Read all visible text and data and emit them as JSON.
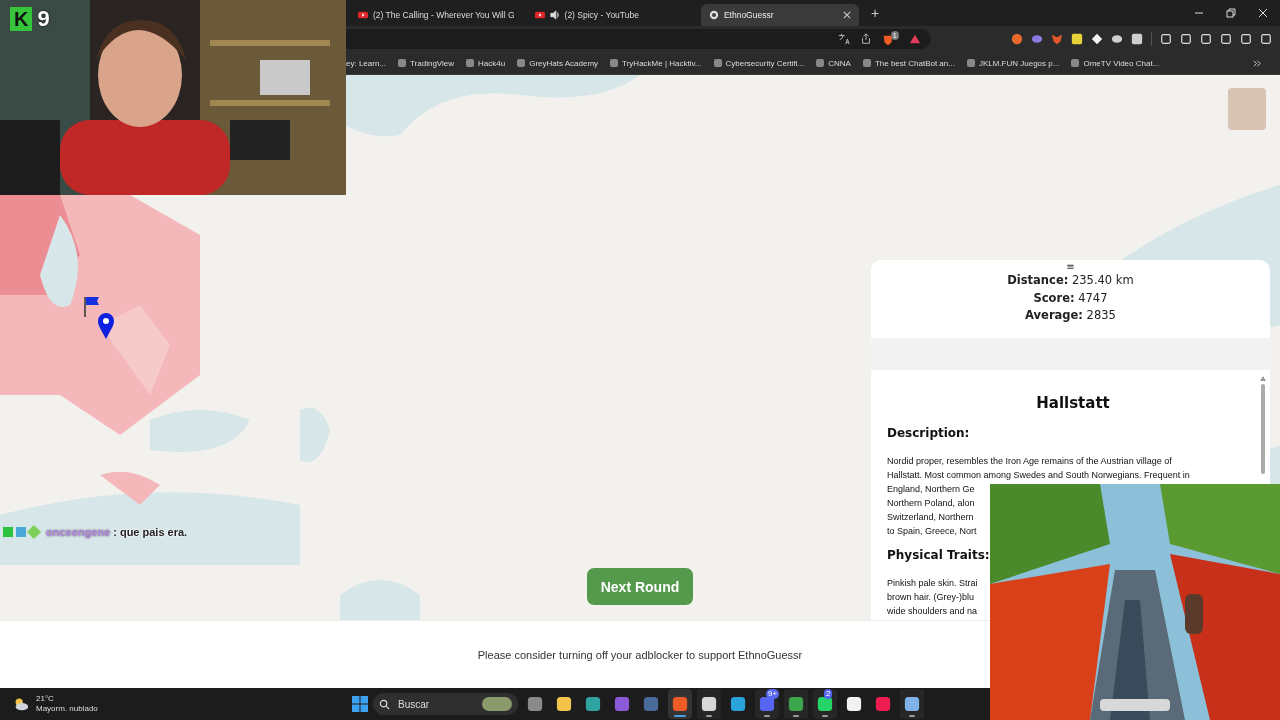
{
  "stream_overlay": {
    "logo_mark": "K",
    "logo_count": "9",
    "chat": {
      "user": "onceengene",
      "message": ": que pais era."
    }
  },
  "browser": {
    "tabs": [
      {
        "title": "(2) The Calling - Wherever You Will G",
        "selected": false,
        "audible": false
      },
      {
        "title": "(2) Spicy - YouTube",
        "selected": false,
        "audible": true
      },
      {
        "title": "EthnoGuessr",
        "selected": true,
        "audible": false
      }
    ],
    "new_tab": "+",
    "shield_badge": "1",
    "bookmarks": [
      "ey: Learn...",
      "TradingView",
      "Hack4u",
      "GreyHats Academy",
      "TryHackMe | Hacktiv...",
      "Cybersecurity Certifi...",
      "CNNA",
      "The best ChatBot an...",
      "JKLM.FUN Juegos p...",
      "OmeTV Video Chat..."
    ]
  },
  "result": {
    "menu_glyph": "≡",
    "stats": [
      {
        "label": "Distance:",
        "value": "235.40 km"
      },
      {
        "label": "Score:",
        "value": "4747"
      },
      {
        "label": "Average:",
        "value": "2835"
      }
    ],
    "type_name": "Hallstatt",
    "sections": [
      {
        "heading": "Description:",
        "lines": [
          "Nordid proper, resembles the Iron Age remains of the Austrian village of",
          "Hallstatt. Most common among Swedes and South Norwegians. Frequent in",
          "England, Northern Ge",
          "Northern Poland, alon",
          "Switzerland, Northern",
          "to Spain, Greece, Nort"
        ]
      },
      {
        "heading": "Physical Traits:",
        "lines": [
          "Pinkish pale skin. Strai",
          "brown hair. (Grey-)blu",
          "wide shoulders and na"
        ]
      }
    ]
  },
  "next_round": "Next Round",
  "footer": "Please consider turning off your adblocker to support EthnoGuessr",
  "taskbar": {
    "weather": {
      "temperature": "21°C",
      "condition": "Mayorm. nublado"
    },
    "search_placeholder": "Buscar",
    "apps": [
      {
        "running": false,
        "selected": false
      },
      {
        "running": false,
        "selected": false
      },
      {
        "running": false,
        "selected": false
      },
      {
        "running": false,
        "selected": false
      },
      {
        "running": false,
        "selected": false
      },
      {
        "running": true,
        "selected": true
      },
      {
        "running": true,
        "selected": false
      },
      {
        "running": false,
        "selected": false
      },
      {
        "running": true,
        "selected": false,
        "badge": "9+"
      },
      {
        "running": true,
        "selected": false
      },
      {
        "running": true,
        "selected": false,
        "badge": "2"
      },
      {
        "running": false,
        "selected": false
      },
      {
        "running": false,
        "selected": false
      },
      {
        "running": true,
        "selected": false
      }
    ]
  }
}
